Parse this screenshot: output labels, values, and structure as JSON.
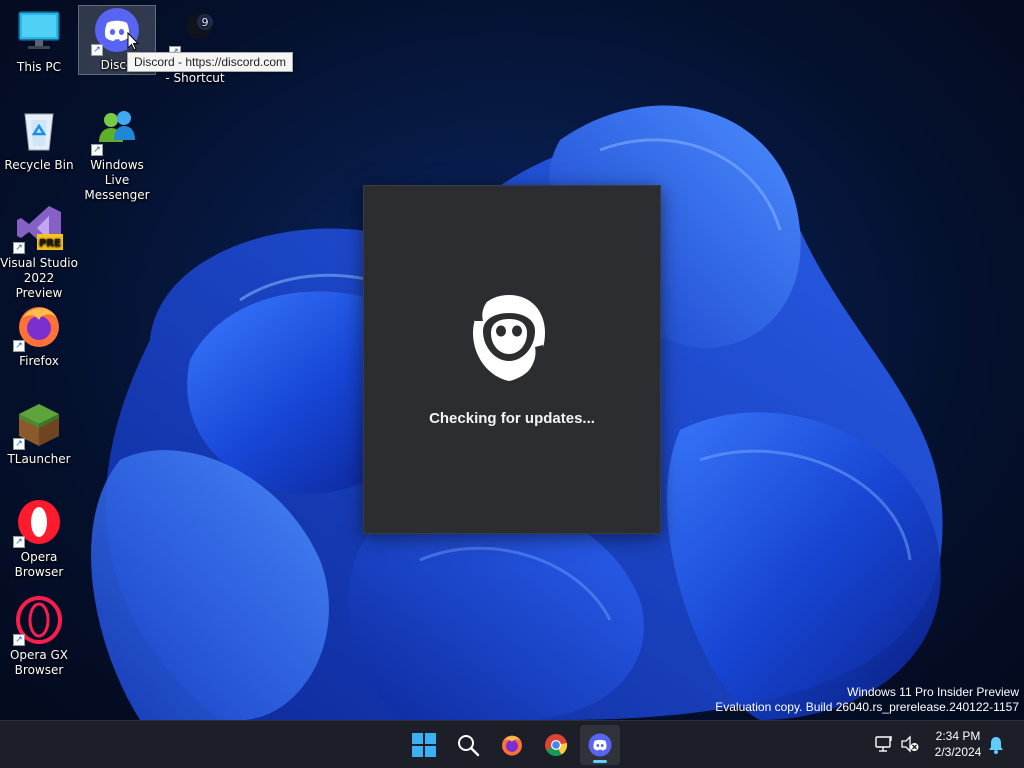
{
  "desktop": {
    "icons": [
      {
        "name": "This PC",
        "label": "This PC"
      },
      {
        "name": "Discord",
        "label": "Disco"
      },
      {
        "name": "Shortcut",
        "label": "- Shortcut"
      },
      {
        "name": "Recycle Bin",
        "label": "Recycle Bin"
      },
      {
        "name": "Windows Live Messenger",
        "label": "Windows Live Messenger"
      },
      {
        "name": "Visual Studio 2022 Preview",
        "label": "Visual Studio 2022 Preview",
        "badge": "PRE"
      },
      {
        "name": "Firefox",
        "label": "Firefox"
      },
      {
        "name": "TLauncher",
        "label": "TLauncher"
      },
      {
        "name": "Opera Browser",
        "label": "Opera Browser"
      },
      {
        "name": "Opera GX Browser",
        "label": "Opera GX Browser"
      }
    ]
  },
  "tooltip": {
    "text": "Discord - https://discord.com"
  },
  "updater": {
    "status": "Checking for updates..."
  },
  "watermark": {
    "line1": "Windows 11 Pro Insider Preview",
    "line2": "Evaluation copy. Build 26040.rs_prerelease.240122-1157"
  },
  "taskbar": {
    "apps": [
      "start-icon",
      "search-icon",
      "firefox-icon",
      "chrome-icon",
      "discord-icon"
    ],
    "active_app": "Discord",
    "time": "2:34 PM",
    "date": "2/3/2024"
  },
  "colors": {
    "discord_blurple": "#5865f2",
    "updater_bg": "#2b2d31",
    "taskbar_bg": "#1c1f27",
    "accent": "#60cdff"
  }
}
